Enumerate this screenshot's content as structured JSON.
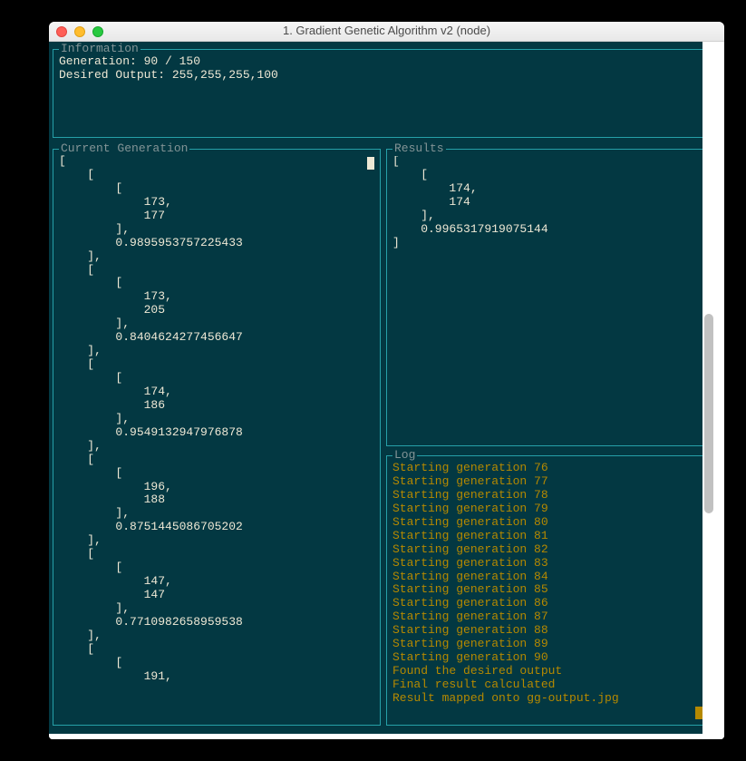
{
  "window": {
    "title": "1. Gradient Genetic Algorithm v2 (node)"
  },
  "info": {
    "panel_label": "Information",
    "body": "Generation: 90 / 150\nDesired Output: 255,255,255,100"
  },
  "current_generation": {
    "panel_label": "Current Generation",
    "body": "[\n    [\n        [\n            173,\n            177\n        ],\n        0.9895953757225433\n    ],\n    [\n        [\n            173,\n            205\n        ],\n        0.8404624277456647\n    ],\n    [\n        [\n            174,\n            186\n        ],\n        0.9549132947976878\n    ],\n    [\n        [\n            196,\n            188\n        ],\n        0.8751445086705202\n    ],\n    [\n        [\n            147,\n            147\n        ],\n        0.7710982658959538\n    ],\n    [\n        [\n            191,"
  },
  "results": {
    "panel_label": "Results",
    "body": "[\n    [\n        174,\n        174\n    ],\n    0.9965317919075144\n]"
  },
  "log": {
    "panel_label": "Log",
    "lines": [
      "Starting generation 76",
      "Starting generation 77",
      "Starting generation 78",
      "Starting generation 79",
      "Starting generation 80",
      "Starting generation 81",
      "Starting generation 82",
      "Starting generation 83",
      "Starting generation 84",
      "Starting generation 85",
      "Starting generation 86",
      "Starting generation 87",
      "Starting generation 88",
      "Starting generation 89",
      "Starting generation 90",
      "Found the desired output",
      "Final result calculated",
      "Result mapped onto gg-output.jpg"
    ]
  }
}
